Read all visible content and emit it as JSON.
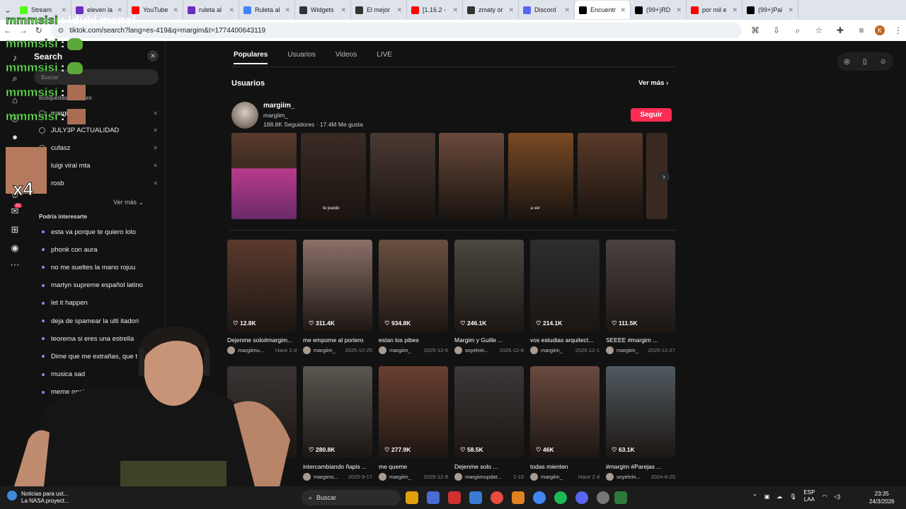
{
  "browser": {
    "tabs": [
      {
        "label": "Stream",
        "color": "#53fc18"
      },
      {
        "label": "eleven la",
        "color": "#6b2fbf"
      },
      {
        "label": "YouTube",
        "color": "#ff0000"
      },
      {
        "label": "ruleta al",
        "color": "#6b2fbf"
      },
      {
        "label": "Ruleta al",
        "color": "#4285f4"
      },
      {
        "label": "Widgets",
        "color": "#333333"
      },
      {
        "label": "El mejor",
        "color": "#333333"
      },
      {
        "label": "[1.16.2 -",
        "color": "#ff0000"
      },
      {
        "label": "zmaty or",
        "color": "#333333"
      },
      {
        "label": "Discord",
        "color": "#5865f2"
      },
      {
        "label": "Encuentr",
        "color": "#000000"
      },
      {
        "label": "(99+)RD",
        "color": "#000000"
      },
      {
        "label": "por mil e",
        "color": "#ff0000"
      },
      {
        "label": "(99+)Pai",
        "color": "#000000"
      }
    ],
    "url": "tiktok.com/search?lang=es-419&q=margim&t=1774400643119"
  },
  "chat": {
    "lines": [
      {
        "user": "mmmsisi",
        "msg": ": !duki mano!"
      },
      {
        "user": "mmmsisi",
        "msg": ":"
      },
      {
        "user": "mmmsisi",
        "msg": ":"
      },
      {
        "user": "mmmsisi",
        "msg": ":"
      },
      {
        "user": "mmmsisi",
        "msg": ":"
      }
    ],
    "multiplier": "x4"
  },
  "sidebar": {
    "badge": "22"
  },
  "search_panel": {
    "title": "Search",
    "placeholder": "Buscar",
    "recent_label": "Búsquedas recientes",
    "recent": [
      "margim",
      "JULY3P ACTUALIDAD",
      "cufasz",
      "luigi viral mta",
      "rosb"
    ],
    "see_more": "Ver más",
    "interest_label": "Podría interesarte",
    "suggestions": [
      "esta va porque te quiero lolo",
      "phonk con aura",
      "no me sueltes la mano rojuu",
      "martyn supreme español latino",
      "let it happen",
      "deja de spamear la ulti itadori",
      "teorema si eres una estrella",
      "Dime que me extrañas, que t",
      "musica sad",
      "meme ooohh"
    ]
  },
  "main": {
    "tabs": [
      "Populares",
      "Usuarios",
      "Videos",
      "LIVE"
    ],
    "users_heading": "Usuarios",
    "see_more": "Ver más",
    "user": {
      "name": "margiim_",
      "handle": "margiim_",
      "followers": "188.8K Seguidores",
      "likes": "17.4M Me gusta",
      "follow_label": "Seguir"
    },
    "user_thumbs": [
      {
        "color": "#5a3b2c",
        "caption": ""
      },
      {
        "color": "#3b2b25",
        "caption": "te puedo"
      },
      {
        "color": "#4b3a33",
        "caption": ""
      },
      {
        "color": "#6b4a3b",
        "caption": ""
      },
      {
        "color": "#7a4a23",
        "caption": "a ver"
      },
      {
        "color": "#5a3a2a",
        "caption": ""
      }
    ],
    "videos": [
      {
        "likes": "12.8K",
        "title": "Dejenme solo#margim...",
        "author": "margiimu...",
        "date": "Hace 2 d",
        "color": "#5c3a2e"
      },
      {
        "likes": "311.4K",
        "title": "me empome al portero",
        "author": "margiim_",
        "date": "2025-12-25",
        "color": "#8a7068"
      },
      {
        "likes": "934.8K",
        "title": "estan los pibes",
        "author": "margiim_",
        "date": "2025-12-6",
        "color": "#6a5040"
      },
      {
        "likes": "246.1K",
        "title": "Margim y Guille ...",
        "author": "soyelnin...",
        "date": "2025-12-8",
        "color": "#4a4840"
      },
      {
        "likes": "214.1K",
        "title": "vos estudias arquitect...",
        "author": "margiim_",
        "date": "2025-12-1",
        "color": "#2c2e30"
      },
      {
        "likes": "111.5K",
        "title": "SEEEE #margim ...",
        "author": "margiim_",
        "date": "2025-12-27",
        "color": "#4a4240"
      },
      {
        "likes": "",
        "title": "",
        "author": "",
        "date": "",
        "color": "#3a3434"
      },
      {
        "likes": "280.8K",
        "title": "intercambiando ñapis ...",
        "author": "margims...",
        "date": "2025-9-17",
        "color": "#5a5650"
      },
      {
        "likes": "277.9K",
        "title": "me queme",
        "author": "margiim_",
        "date": "2025-12-9",
        "color": "#6a4030"
      },
      {
        "likes": "58.5K",
        "title": "Dejenme solo ...",
        "author": "margiimupdat...",
        "date": "1-15",
        "color": "#3c3838"
      },
      {
        "likes": "46K",
        "title": "todas mienten",
        "author": "margiim_",
        "date": "Hace 2 d",
        "color": "#6a4a40"
      },
      {
        "likes": "63.1K",
        "title": "#margim #Parejas ...",
        "author": "soyelnin...",
        "date": "2024-8-25",
        "color": "#505a60"
      }
    ]
  },
  "taskbar": {
    "news_title": "Noticias para ust...",
    "news_sub": "La NASA proyect...",
    "search": "Buscar",
    "lang": "ESP",
    "lang_sub": "LAA",
    "time": "23:35",
    "date": "24/3/2026"
  }
}
